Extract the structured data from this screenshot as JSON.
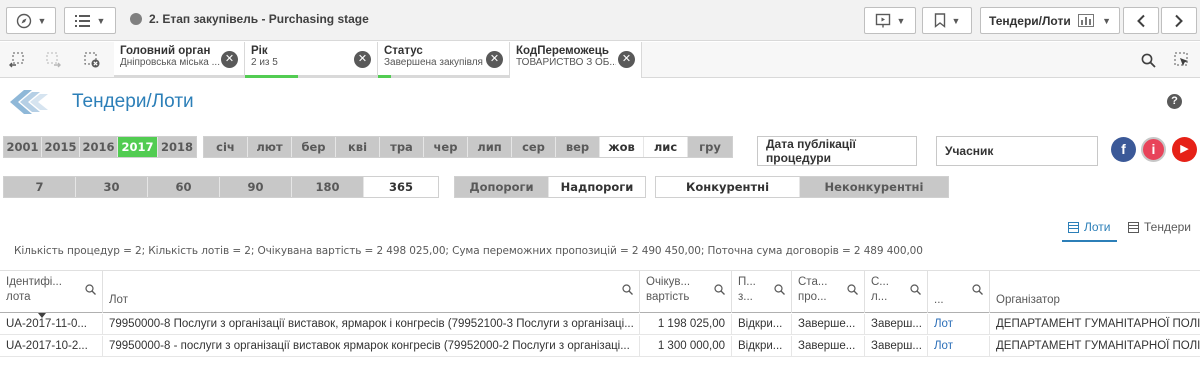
{
  "toolbar": {
    "sheet_title": "2. Етап закупівель - Purchasing stage",
    "sheet_selector_label": "Тендери/Лоти"
  },
  "selections": [
    {
      "name": "Головний орган",
      "value": "Дніпровська міська ...",
      "fill": 0
    },
    {
      "name": "Рік",
      "value": "2 из 5",
      "fill": 0.4
    },
    {
      "name": "Статус",
      "value": "Завершена закупівля",
      "fill": 0.1
    },
    {
      "name": "КодПереможець",
      "value": "ТОВАРИСТВО З ОБ..."
    }
  ],
  "header": {
    "title": "Тендери/Лоти"
  },
  "years": [
    "2001",
    "2015",
    "2016",
    "2017",
    "2018"
  ],
  "years_selected": "2017",
  "months": [
    "січ",
    "лют",
    "бер",
    "кві",
    "тра",
    "чер",
    "лип",
    "сер",
    "вер",
    "жов",
    "лис",
    "гру"
  ],
  "months_white": [
    "жов",
    "лис"
  ],
  "date_field_label": "Дата публікації процедури",
  "participant_field_label": "Учасник",
  "days": [
    "7",
    "30",
    "60",
    "90",
    "180",
    "365"
  ],
  "days_white": [
    "365"
  ],
  "thresholds": [
    "Допороги",
    "Надпороги"
  ],
  "thresholds_white": [
    "Надпороги"
  ],
  "competitive": [
    "Конкурентні",
    "Неконкурентні"
  ],
  "competitive_white": [
    "Конкурентні"
  ],
  "view_tabs": {
    "lots": "Лоти",
    "tenders": "Тендери"
  },
  "summary": "Кількість процедур = 2; Кількість лотів = 2; Очікувана вартість = 2 498 025,00; Сума переможних пропозицій = 2 490 450,00; Поточна сума договорів = 2 489 400,00",
  "table": {
    "headers": {
      "id": [
        "Ідентифі...",
        "лота"
      ],
      "lot": "Лот",
      "value": [
        "Очікув...",
        "вартість"
      ],
      "c4": [
        "П...",
        "з..."
      ],
      "c5": [
        "Ста...",
        "про..."
      ],
      "c6": [
        "С...",
        "л..."
      ],
      "c7": "...",
      "org": "Організатор"
    },
    "rows": [
      {
        "id": "UA-2017-11-0...",
        "lot": "79950000-8 Послуги з організації виставок, ярмарок і конгресів (79952100-3 Послуги з організаці...",
        "value": "1 198 025,00",
        "c4": "Відкри...",
        "c5": "Заверше...",
        "c6": "Заверш...",
        "c7": "Лот",
        "org": "ДЕПАРТАМЕНТ ГУМАНІТАРНОЇ ПОЛІТ"
      },
      {
        "id": "UA-2017-10-2...",
        "lot": "79950000-8 - послуги з організації виставок ярмарок конгресів (79952000-2 Послуги з організаці...",
        "value": "1 300 000,00",
        "c4": "Відкри...",
        "c5": "Заверше...",
        "c6": "Заверш...",
        "c7": "Лот",
        "org": "ДЕПАРТАМЕНТ ГУМАНІТАРНОЇ ПОЛІТ"
      }
    ]
  }
}
